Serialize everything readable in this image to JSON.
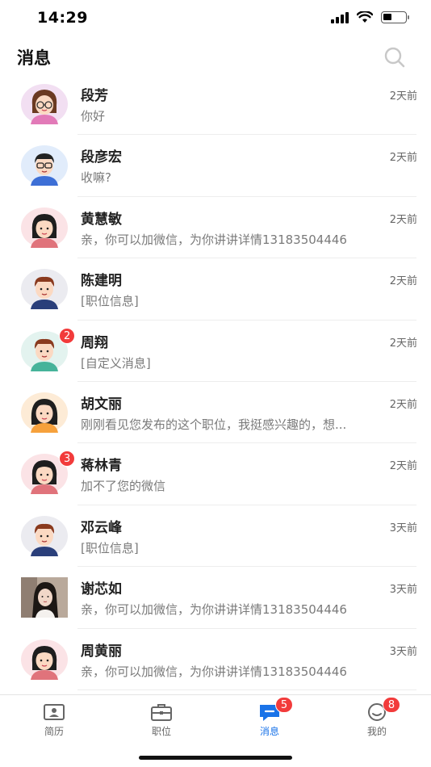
{
  "status_bar": {
    "time": "14:29"
  },
  "header": {
    "title": "消息"
  },
  "conversations": [
    {
      "name": "段芳",
      "time": "2天前",
      "preview": "你好",
      "badge": "",
      "avatar": "female-glasses-avatar-icon"
    },
    {
      "name": "段彦宏",
      "time": "2天前",
      "preview": "收嘛?",
      "badge": "",
      "avatar": "male-glasses-avatar-icon"
    },
    {
      "name": "黄慧敏",
      "time": "2天前",
      "preview": "亲，你可以加微信，为你讲讲详情13183504446",
      "badge": "",
      "avatar": "female-avatar-icon"
    },
    {
      "name": "陈建明",
      "time": "2天前",
      "preview": "[职位信息]",
      "badge": "",
      "avatar": "male-avatar-icon"
    },
    {
      "name": "周翔",
      "time": "2天前",
      "preview": "[自定义消息]",
      "badge": "2",
      "avatar": "male-teal-avatar-icon"
    },
    {
      "name": "胡文丽",
      "time": "2天前",
      "preview": "刚刚看见您发布的这个职位，我挺感兴趣的，想...",
      "badge": "",
      "avatar": "female-orange-avatar-icon"
    },
    {
      "name": "蒋林青",
      "time": "2天前",
      "preview": "加不了您的微信",
      "badge": "3",
      "avatar": "female-avatar-icon"
    },
    {
      "name": "邓云峰",
      "time": "3天前",
      "preview": "[职位信息]",
      "badge": "",
      "avatar": "male-avatar-icon"
    },
    {
      "name": "谢芯如",
      "time": "3天前",
      "preview": "亲，你可以加微信，为你讲讲详情13183504446",
      "badge": "",
      "avatar": "photo-avatar-icon"
    },
    {
      "name": "周黄丽",
      "time": "3天前",
      "preview": "亲，你可以加微信，为你讲讲详情13183504446",
      "badge": "",
      "avatar": "female-avatar-icon"
    }
  ],
  "tabbar": {
    "tabs": [
      {
        "label": "简历",
        "icon": "resume-icon",
        "badge": "",
        "active": false
      },
      {
        "label": "职位",
        "icon": "briefcase-icon",
        "badge": "",
        "active": false
      },
      {
        "label": "消息",
        "icon": "message-icon",
        "badge": "5",
        "active": true
      },
      {
        "label": "我的",
        "icon": "profile-icon",
        "badge": "8",
        "active": false
      }
    ]
  },
  "colors": {
    "accent": "#1a73e8",
    "badge": "#f23b3b",
    "text": "#222222",
    "muted": "#7a7a7a"
  }
}
